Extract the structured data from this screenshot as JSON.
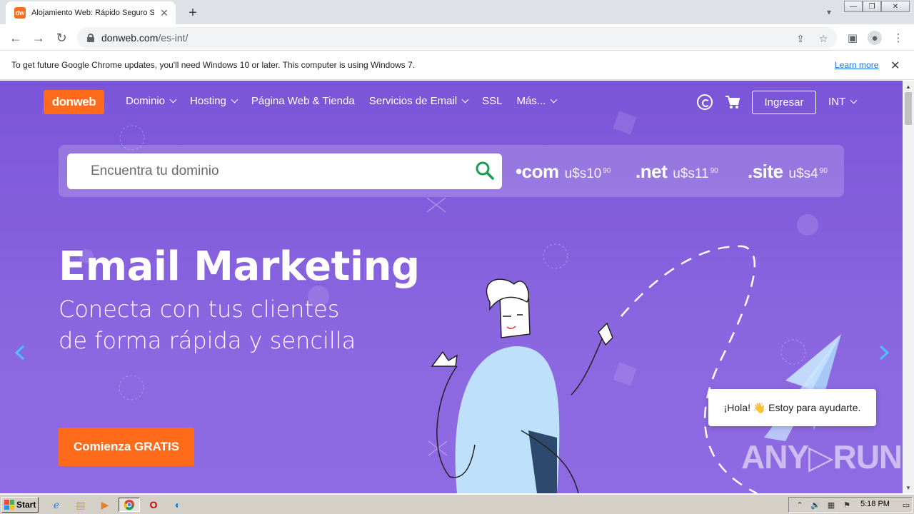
{
  "browser": {
    "tab_title": "Alojamiento Web: Rápido Seguro So",
    "favicon_text": "dw",
    "new_tab": "+",
    "url_host": "donweb.com",
    "url_path": "/es-int/"
  },
  "infobar": {
    "message": "To get future Google Chrome updates, you'll need Windows 10 or later. This computer is using Windows 7.",
    "link": "Learn more"
  },
  "site": {
    "logo": "donweb",
    "nav": [
      {
        "label": "Dominio",
        "dropdown": true
      },
      {
        "label": "Hosting",
        "dropdown": true
      },
      {
        "label": "Página Web & Tienda",
        "dropdown": false
      },
      {
        "label": "Servicios de Email",
        "dropdown": true
      },
      {
        "label": "SSL",
        "dropdown": false
      },
      {
        "label": "Más...",
        "dropdown": true
      }
    ],
    "login": "Ingresar",
    "lang": "INT",
    "search_placeholder": "Encuentra tu dominio",
    "tlds": [
      {
        "name": "•com",
        "price": "u$s10",
        "cents": "90"
      },
      {
        "name": ".net",
        "price": "u$s11",
        "cents": "90"
      },
      {
        "name": ".site",
        "price": "u$s4",
        "cents": "90"
      }
    ],
    "hero_title": "Email Marketing",
    "hero_sub_1": "Conecta con tus clientes",
    "hero_sub_2": "de forma rápida y sencilla",
    "cta": "Comienza GRATIS",
    "chat": "¡Hola! 👋 Estoy para ayudarte.",
    "watermark": "ANY▷RUN"
  },
  "taskbar": {
    "start": "Start",
    "clock": "5:18 PM"
  },
  "colors": {
    "brand_orange": "#ff6b1a",
    "hero_purple": "#7b55d8"
  }
}
